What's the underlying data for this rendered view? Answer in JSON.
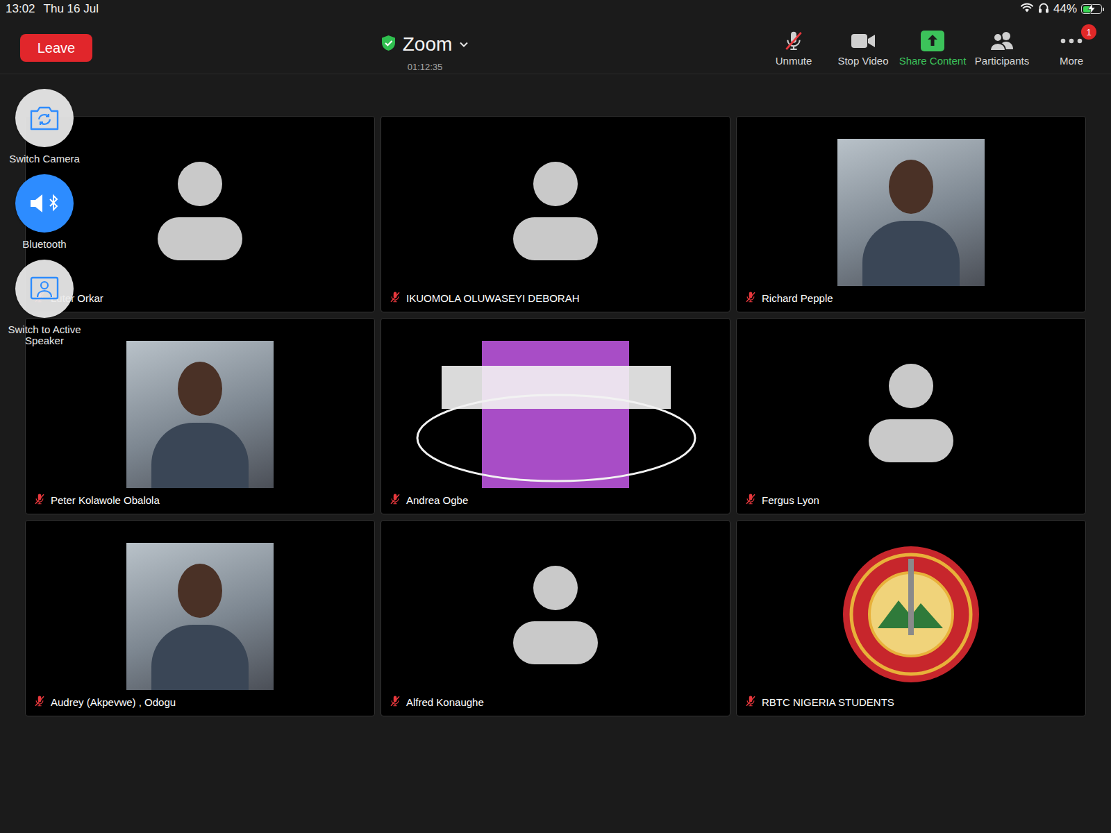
{
  "status_bar": {
    "time": "13:02",
    "date": "Thu 16 Jul",
    "battery": "44%",
    "battery_level": 0.44,
    "charging": true
  },
  "toolbar": {
    "leave": "Leave",
    "title": "Zoom",
    "encrypted": true,
    "timer": "01:12:35",
    "buttons": [
      {
        "label": "Unmute",
        "kind": "mic",
        "muted": true,
        "color": "#d8d8d8"
      },
      {
        "label": "Stop Video",
        "kind": "video",
        "color": "#d8d8d8"
      },
      {
        "label": "Share Content",
        "kind": "share",
        "color": "#3cc35a"
      },
      {
        "label": "Participants",
        "kind": "participants",
        "color": "#d8d8d8"
      },
      {
        "label": "More",
        "kind": "more",
        "badge": "1",
        "color": "#d8d8d8"
      }
    ]
  },
  "side_controls": [
    {
      "label": "Switch Camera",
      "kind": "camera",
      "active": false
    },
    {
      "label": "Bluetooth",
      "kind": "bluetooth",
      "active": true
    },
    {
      "label": "Switch to Active Speaker",
      "kind": "speaker",
      "active": false
    }
  ],
  "participants": [
    {
      "name": "Luter Orkar",
      "kind": "avatar",
      "muted": true
    },
    {
      "name": "IKUOMOLA OLUWASEYI DEBORAH",
      "kind": "avatar",
      "muted": true
    },
    {
      "name": "Richard Pepple",
      "kind": "photo",
      "muted": true
    },
    {
      "name": "Peter Kolawole Obalola",
      "kind": "photo",
      "muted": true
    },
    {
      "name": "Andrea Ogbe",
      "kind": "banner",
      "muted": true
    },
    {
      "name": "Fergus Lyon",
      "kind": "avatar",
      "muted": true
    },
    {
      "name": "Audrey (Akpevwe) , Odogu",
      "kind": "photo",
      "muted": true
    },
    {
      "name": "Alfred Konaughe",
      "kind": "avatar",
      "muted": true
    },
    {
      "name": "RBTC NIGERIA STUDENTS",
      "kind": "seal",
      "muted": true
    }
  ]
}
